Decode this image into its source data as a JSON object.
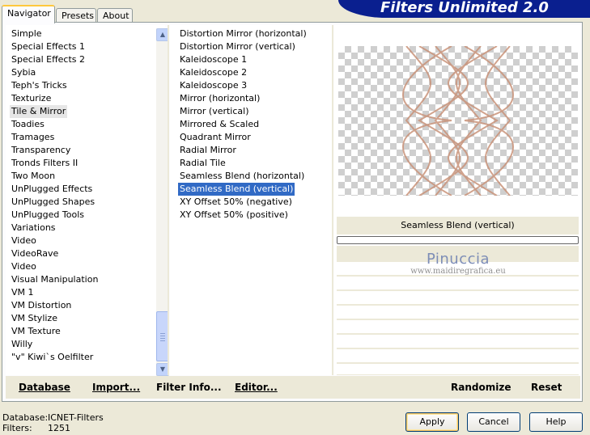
{
  "window": {
    "title": "Filters Unlimited 2.0"
  },
  "tabs": [
    {
      "label": "Navigator",
      "active": true
    },
    {
      "label": "Presets",
      "active": false
    },
    {
      "label": "About",
      "active": false
    }
  ],
  "categories": [
    "Simple",
    "Special Effects 1",
    "Special Effects 2",
    "Sybia",
    "Teph's Tricks",
    "Texturize",
    "Tile & Mirror",
    "Toadies",
    "Tramages",
    "Transparency",
    "Tronds Filters II",
    "Two Moon",
    "UnPlugged Effects",
    "UnPlugged Shapes",
    "UnPlugged Tools",
    "Variations",
    "Video",
    "VideoRave",
    "Video",
    "Visual Manipulation",
    "VM 1",
    "VM Distortion",
    "VM Stylize",
    "VM Texture",
    "Willy",
    "\"v\" Kiwi`s Oelfilter"
  ],
  "selected_category": "Tile & Mirror",
  "filters": [
    "Distortion Mirror (horizontal)",
    "Distortion Mirror (vertical)",
    "Kaleidoscope 1",
    "Kaleidoscope 2",
    "Kaleidoscope 3",
    "Mirror (horizontal)",
    "Mirror (vertical)",
    "Mirrored & Scaled",
    "Quadrant Mirror",
    "Radial Mirror",
    "Radial Tile",
    "Seamless Blend (horizontal)",
    "Seamless Blend (vertical)",
    "XY Offset 50% (negative)",
    "XY Offset 50% (positive)"
  ],
  "selected_filter": "Seamless Blend (vertical)",
  "preview": {
    "caption": "Seamless Blend (vertical)",
    "progress_fraction": 0
  },
  "watermark": {
    "name": "Pinuccia",
    "url": "www.maidiregrafica.eu"
  },
  "toolbar": {
    "database": "Database",
    "import": "Import...",
    "filter_info": "Filter Info...",
    "editor": "Editor...",
    "randomize": "Randomize",
    "reset": "Reset"
  },
  "status": {
    "database_label": "Database:",
    "database_value": "ICNET-Filters",
    "filters_label": "Filters:",
    "filters_value": "1251"
  },
  "buttons": {
    "apply": "Apply",
    "cancel": "Cancel",
    "help": "Help"
  },
  "colors": {
    "banner": "#0a1f8f",
    "selection": "#316ac5",
    "preview_lines": "#c9937a"
  },
  "icons": {
    "scroll_up": "chevron-up-icon",
    "scroll_down": "chevron-down-icon"
  }
}
